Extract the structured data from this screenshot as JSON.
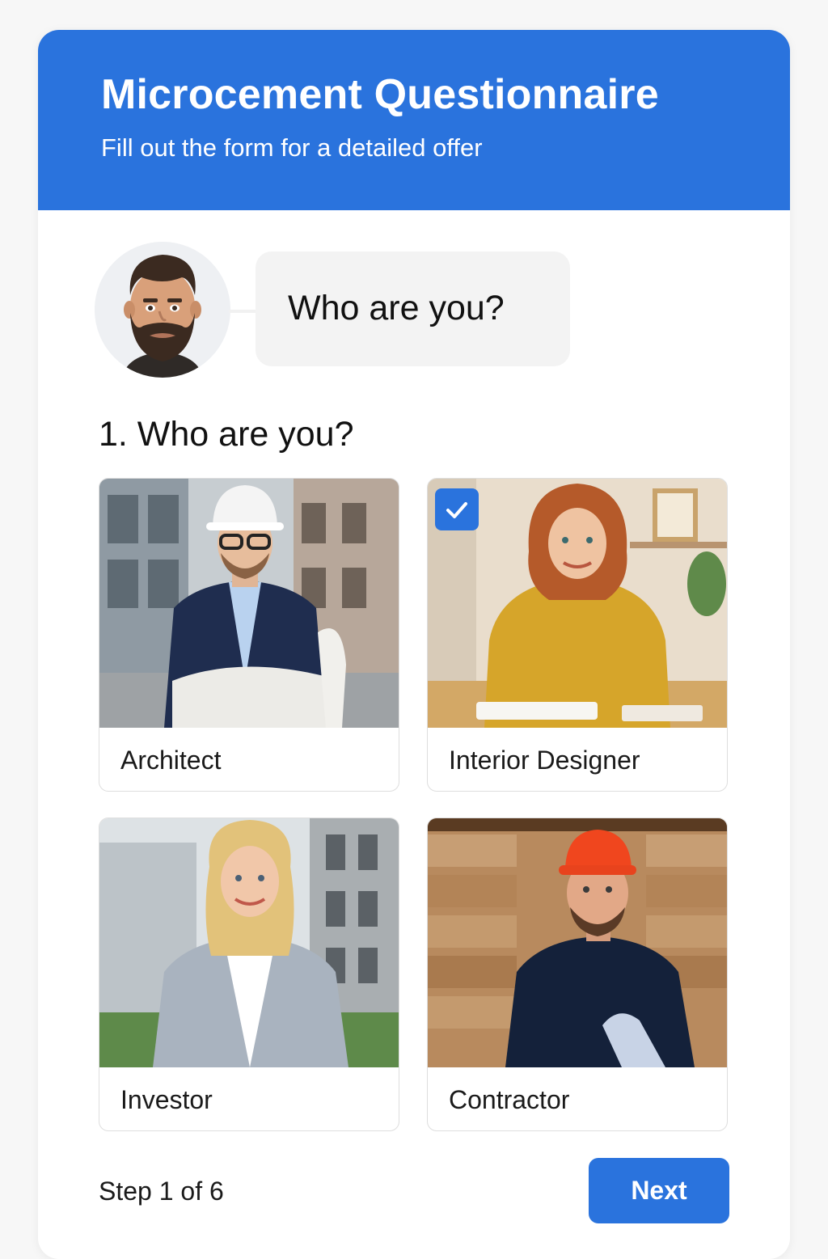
{
  "header": {
    "title": "Microcement Questionnaire",
    "subtitle": "Fill out the form for a detailed offer"
  },
  "chat": {
    "avatar_icon": "bearded-man-avatar-icon",
    "bubble_text": "Who are you?"
  },
  "question": {
    "label": "1. Who are you?",
    "options": [
      {
        "label": "Architect",
        "selected": false
      },
      {
        "label": "Interior Designer",
        "selected": true
      },
      {
        "label": "Investor",
        "selected": false
      },
      {
        "label": "Contractor",
        "selected": false
      }
    ]
  },
  "footer": {
    "step_text": "Step 1 of 6",
    "next_label": "Next"
  },
  "colors": {
    "accent": "#2a73dd",
    "page_background": "#f7f7f7"
  }
}
